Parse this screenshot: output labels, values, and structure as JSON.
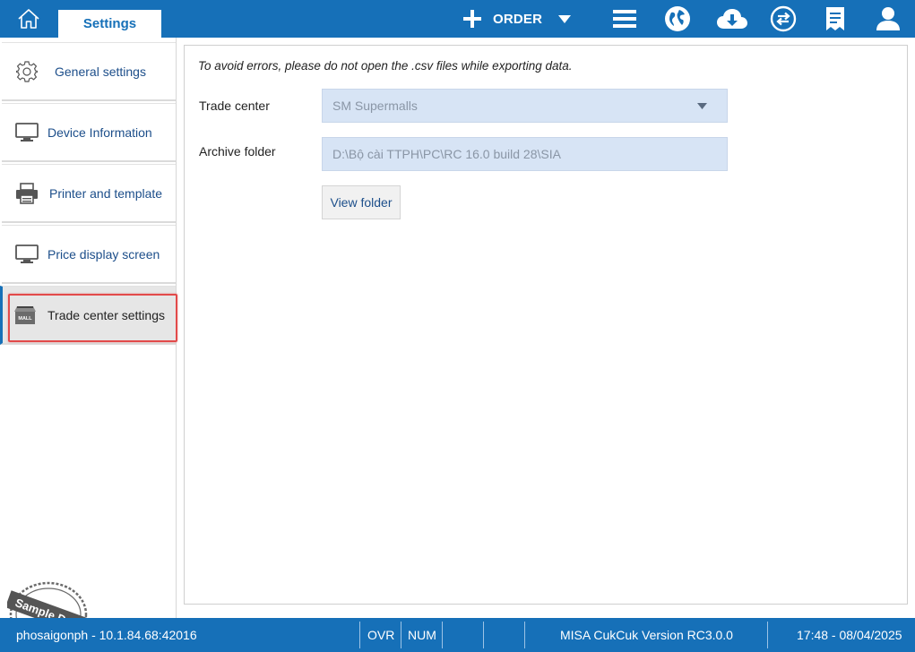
{
  "header": {
    "settings_tab": "Settings",
    "order_label": "ORDER",
    "icons": [
      "home-icon",
      "plus-icon",
      "chevron-down-icon",
      "menu-icon",
      "globe-icon",
      "cloud-download-icon",
      "sync-icon",
      "receipt-icon",
      "user-icon"
    ],
    "accent_color": "#1670b8"
  },
  "sidebar": {
    "items": [
      {
        "label": "General settings",
        "icon": "gear-icon"
      },
      {
        "label": "Device Information",
        "icon": "monitor-icon"
      },
      {
        "label": "Printer and template",
        "icon": "printer-icon"
      },
      {
        "label": "Price display screen",
        "icon": "monitor-icon"
      },
      {
        "label": "Trade center settings",
        "icon": "mall-icon",
        "active": true
      }
    ],
    "highlight_color": "#e24a4a"
  },
  "content": {
    "warning": "To avoid errors, please do not open the .csv files while exporting data.",
    "trade_center_label": "Trade center",
    "trade_center_value": "SM Supermalls",
    "archive_folder_label": "Archive folder",
    "archive_folder_value": "D:\\Bộ cài TTPH\\PC\\RC 16.0 build 28\\SIA",
    "view_folder_button": "View folder"
  },
  "watermark": {
    "text": "Sample Data"
  },
  "statusbar": {
    "connection": "phosaigonph - 10.1.84.68:42016",
    "ovr": "OVR",
    "num": "NUM",
    "version": "MISA CukCuk Version RC3.0.0",
    "datetime": "17:48 - 08/04/2025"
  }
}
